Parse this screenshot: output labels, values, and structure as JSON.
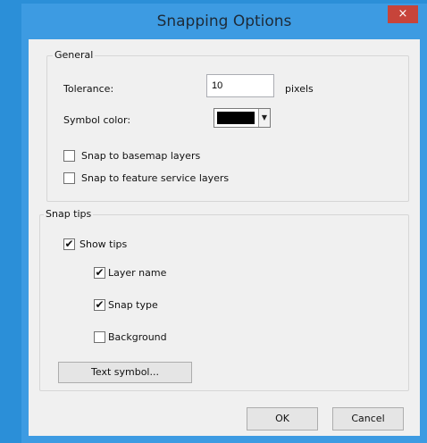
{
  "window": {
    "title": "Snapping Options",
    "close_label": "×"
  },
  "general": {
    "group_label": "General",
    "tolerance_label": "Tolerance:",
    "tolerance_value": "10",
    "tolerance_unit": "pixels",
    "symbol_color_label": "Symbol color:",
    "symbol_color": "#000000",
    "snap_basemap_label": "Snap to basemap layers",
    "snap_basemap_checked": false,
    "snap_feature_label": "Snap to feature service layers",
    "snap_feature_checked": false
  },
  "snap_tips": {
    "group_label": "Snap tips",
    "show_tips_label": "Show tips",
    "show_tips_checked": true,
    "layer_name_label": "Layer name",
    "layer_name_checked": true,
    "snap_type_label": "Snap type",
    "snap_type_checked": true,
    "background_label": "Background",
    "background_checked": false,
    "text_symbol_button": "Text symbol..."
  },
  "buttons": {
    "ok": "OK",
    "cancel": "Cancel"
  },
  "check_glyph": "✔"
}
